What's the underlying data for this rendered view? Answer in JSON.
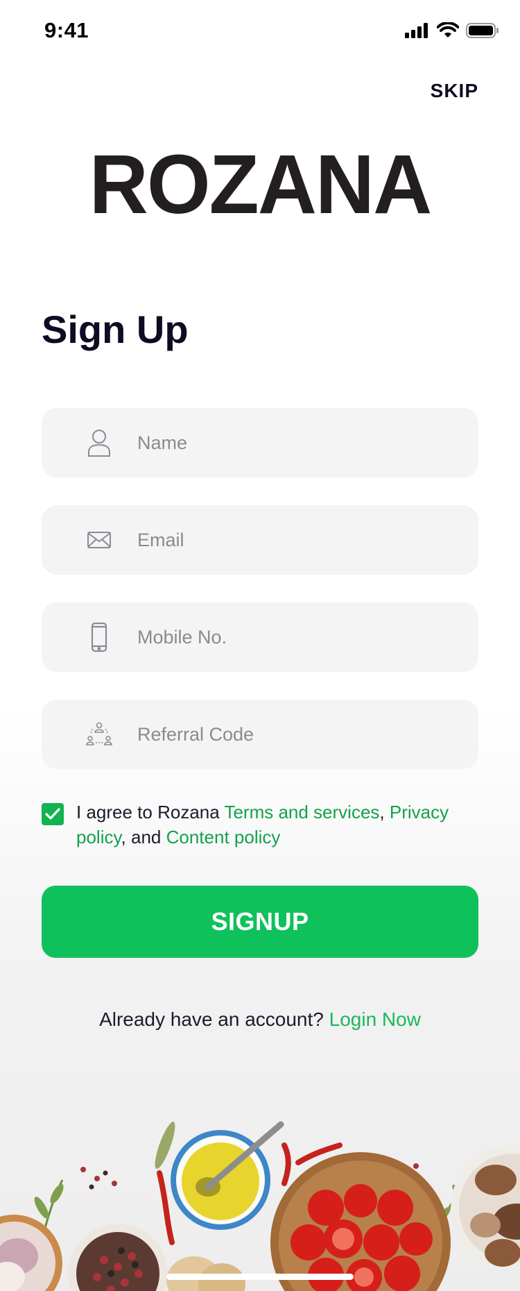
{
  "status_bar": {
    "time": "9:41"
  },
  "header": {
    "skip_label": "SKIP",
    "logo_text": "ROZANA"
  },
  "page": {
    "title": "Sign Up"
  },
  "form": {
    "name_placeholder": "Name",
    "email_placeholder": "Email",
    "mobile_placeholder": "Mobile No.",
    "referral_placeholder": "Referral Code",
    "agree_checked": true
  },
  "agreement": {
    "prefix": "I agree to Rozana ",
    "terms_link": "Terms and services",
    "sep1": ", ",
    "privacy_link": "Privacy policy",
    "sep2": ", and ",
    "content_link": "Content policy"
  },
  "signup_label": "SIGNUP",
  "footer": {
    "prompt": "Already have an account? ",
    "login_link": "Login Now"
  },
  "colors": {
    "accent": "#0fc15b",
    "link": "#12a24b",
    "field_bg": "#f5f4f5",
    "text": "#0d0c22"
  }
}
